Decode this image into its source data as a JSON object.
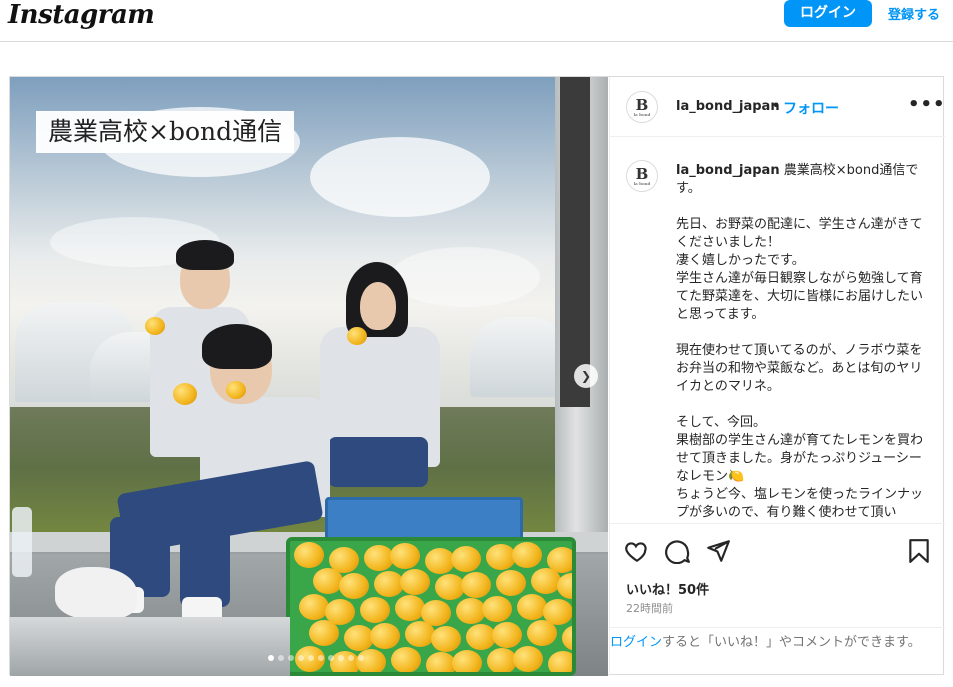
{
  "nav": {
    "logo": "Instagram",
    "login_label": "ログイン",
    "signup_label": "登録する"
  },
  "post": {
    "image_overlay_text": "農業高校×bond通信",
    "carousel": {
      "count": 10,
      "active": 0
    },
    "username": "la_bond_japan",
    "separator": "•",
    "follow_label": "フォロー",
    "more_label": "•••",
    "avatar_letter": "B",
    "avatar_sub": "la bond",
    "caption_text": "農業高校×bond通信です。\n\n先日、お野菜の配達に、学生さん達がきてくださいました！\n凄く嬉しかったです。\n学生さん達が毎日観察しながら勉強して育てた野菜達を、大切に皆様にお届けしたいと思ってます。\n\n現在使わせて頂いてるのが、ノラボウ菜をお弁当の和物や菜飯など。あとは旬のヤリイカとのマリネ。\n\nそして、今回。\n果樹部の学生さん達が育てたレモンを買わせて頂きました。身がたっぷりジューシーなレモン🍋\nちょうど今、塩レモンを使ったラインナップが多いので、有り難く使わせて頂い",
    "likes": "いいね！50件",
    "timestamp": "22時間前",
    "login_link": "ログイン",
    "login_prompt_rest": "すると「いいね！」やコメントができます。",
    "icons": [
      "heart-icon",
      "comment-icon",
      "share-icon",
      "bookmark-icon"
    ]
  },
  "colors": {
    "accent": "#0095f6",
    "text": "#262626",
    "muted": "#8e8e8e",
    "border": "#dbdbdb"
  }
}
